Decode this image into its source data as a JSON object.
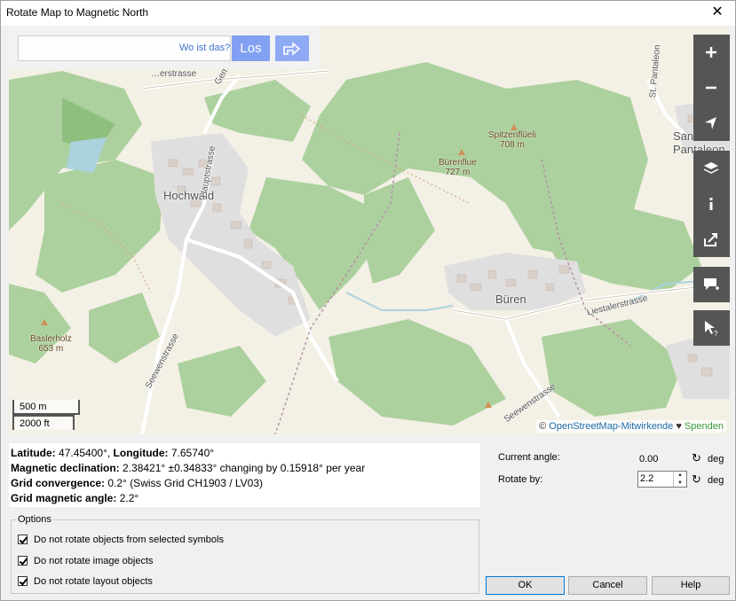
{
  "window": {
    "title": "Rotate Map to Magnetic North",
    "close_glyph": "✕"
  },
  "search": {
    "placeholder": "Wo ist das?",
    "go_label": "Los"
  },
  "map": {
    "places": [
      "Hochwald",
      "Büren",
      "Sankt Pantaleon"
    ],
    "peaks": [
      {
        "name": "Spitzenflüeli",
        "elevation": "708 m"
      },
      {
        "name": "Bürenflue",
        "elevation": "727 m"
      },
      {
        "name": "Baslerholz",
        "elevation": "653 m"
      }
    ],
    "roads": [
      "Gempenstrasse",
      "Hauptstrasse",
      "Seewenstrasse",
      "Liestalerstrasse",
      "Seewenstrasse",
      "St. Pantaleon"
    ],
    "road_prefix": "…erstrasse",
    "scale_metric": "500 m",
    "scale_imperial": "2000 ft",
    "attribution_prefix": "©",
    "attribution_link": "OpenStreetMap-Mitwirkende",
    "attribution_heart": "♥",
    "attribution_donate": "Spenden",
    "tools": [
      "zoom-in-icon",
      "zoom-out-icon",
      "locate-icon",
      "layers-icon",
      "info-icon",
      "share-icon",
      "note-icon",
      "query-icon"
    ],
    "colors": {
      "background": "#f3f0e6",
      "forest": "#add19e",
      "forest_dark": "#8fbf7f",
      "buildings": "#d9d0c9",
      "residential": "#e0dfdf",
      "road": "#ffffff",
      "water": "#aad3df",
      "tool_bg": "#555555",
      "search_btn": "#7f9ff3"
    }
  },
  "info": {
    "latitude_label": "Latitude:",
    "latitude_value": "47.45400°,",
    "longitude_label": "Longitude:",
    "longitude_value": "7.65740°",
    "declination_label": "Magnetic declination:",
    "declination_value": "2.38421° ±0.34833° changing by 0.15918° per year",
    "convergence_label": "Grid convergence:",
    "convergence_value": "0.2° (Swiss Grid  CH1903 / LV03)",
    "grid_angle_label": "Grid magnetic angle:",
    "grid_angle_value": "2.2°"
  },
  "angles": {
    "current_label": "Current angle:",
    "current_value": "0.00",
    "rotate_label": "Rotate by:",
    "rotate_value": "2.2",
    "unit": "deg",
    "reset_glyph": "↻"
  },
  "options": {
    "legend": "Options",
    "items": [
      {
        "label": "Do not rotate objects from selected symbols",
        "checked": true
      },
      {
        "label": "Do not rotate image objects",
        "checked": true
      },
      {
        "label": "Do not rotate layout objects",
        "checked": true
      }
    ]
  },
  "buttons": {
    "ok": "OK",
    "cancel": "Cancel",
    "help": "Help"
  }
}
